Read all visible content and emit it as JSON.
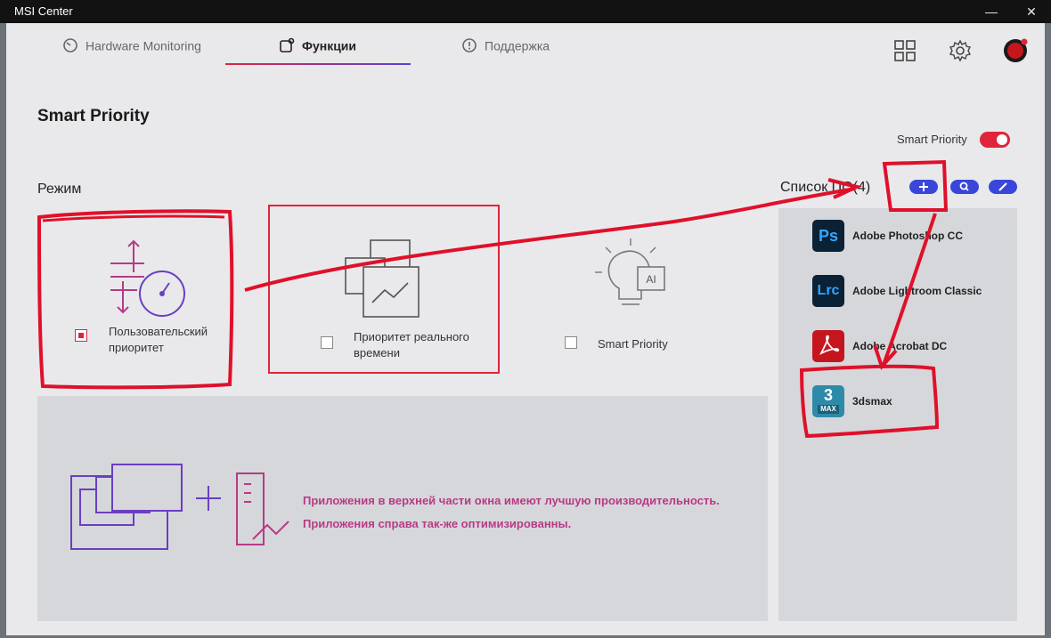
{
  "window": {
    "title": "MSI Center"
  },
  "tabs": [
    {
      "label": "Hardware Monitoring"
    },
    {
      "label": "Функции"
    },
    {
      "label": "Поддержка"
    }
  ],
  "page": {
    "title": "Smart Priority",
    "toggle_label": "Smart Priority",
    "toggle_on": true
  },
  "modes": {
    "section_label": "Режим",
    "items": [
      {
        "label_line1": "Пользовательский",
        "label_line2": "приоритет",
        "checked": true
      },
      {
        "label_line1": "Приоритет реального",
        "label_line2": "времени",
        "checked": false
      },
      {
        "label_line1": "Smart Priority",
        "label_line2": "",
        "checked": false
      }
    ]
  },
  "info": {
    "line1": "Приложения в верхней части окна имеют лучшую производительность.",
    "line2": "Приложения справа так-же оптимизированны."
  },
  "app_list": {
    "title": "Список ПО(4)",
    "apps": [
      {
        "icon_text": "Ps",
        "name": "Adobe Photoshop CC",
        "color": "#0b2135",
        "fg": "#31a8ff"
      },
      {
        "icon_text": "Lrc",
        "name": "Adobe Lightroom Classic",
        "color": "#0b2135",
        "fg": "#31a8ff"
      },
      {
        "icon_text": "",
        "name": "Adobe Acrobat DC",
        "color": "#c4161c",
        "fg": "#ffffff"
      },
      {
        "icon_text": "3",
        "icon_subtext": "MAX",
        "name": "3dsmax",
        "color": "#2d8aa8",
        "fg": "#ffffff"
      }
    ]
  },
  "colors": {
    "accent": "#e0243b",
    "purple": "#5b3fd6",
    "pill_blue": "#3a46d9",
    "info_text": "#b73a86"
  }
}
